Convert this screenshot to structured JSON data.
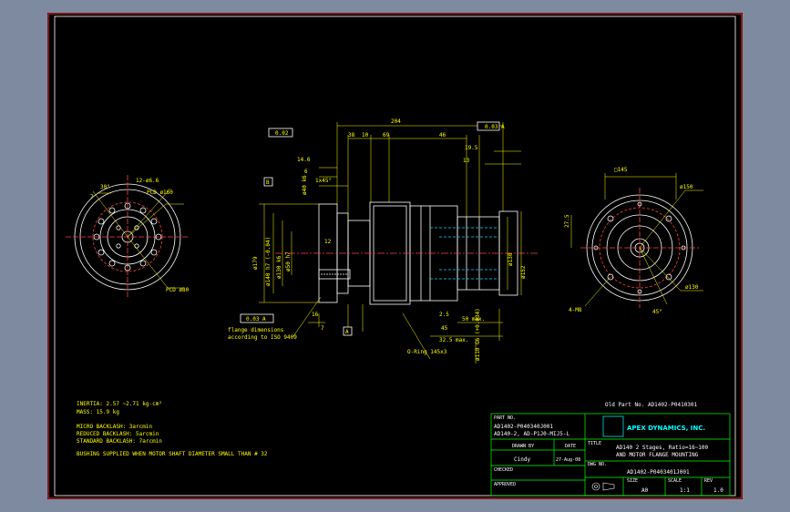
{
  "drawing": {
    "side_dims": {
      "overall": "204",
      "d1": "38",
      "d2": "10",
      "d3": "69",
      "d4": "46",
      "d5": "19.5",
      "d6": "13",
      "d7": "14.6",
      "d8": "6",
      "d9": "1x45°",
      "d10": "12",
      "d11": "16",
      "d12": "7",
      "d13": "2.5",
      "d14": "50 max.",
      "d15": "32.5 max.",
      "d16": "45",
      "dia1": "ø179",
      "dia2": "ø140 h7 (-0.04)",
      "dia3": "ø130 k6",
      "dia4": "ø50 h7",
      "dia5": "ø152",
      "dia6": "ø130",
      "dia7": "ø110 G6 (+0.034)",
      "dia8": "ø40 k6",
      "flatness": "0.03 A",
      "runout": "0.02",
      "runout2": "0.03 A",
      "key_a": "A",
      "key_b": "B",
      "oring": "O-Ring 145x3",
      "flange_note_1": "flange dimensions",
      "flange_note_2": "according to ISO 9409"
    },
    "left_view": {
      "angle": "30°",
      "holes": "12-ø6.6",
      "pcd1": "PCD ø160",
      "pcd2": "PCD ø80",
      "thread": "7"
    },
    "right_view": {
      "sq": "□145",
      "dia_a": "ø150",
      "dia_b": "ø130",
      "h": "27.5",
      "threads": "4-M8",
      "angle": "45°"
    },
    "notes": {
      "inertia": "INERTIA:  2.57 ~2.71 kg-cm²",
      "mass": "MASS: 15.9 kg",
      "micro": "MICRO BACKLASH: 3arcmin",
      "reduced": "REDUCED BACKLASH: 5arcmin",
      "standard": "STANDARD BACKLASH: 7arcmin",
      "bushing": "BUSHING SUPPLIED WHEN MOTOR SHAFT DIAMETER SMALL THAN # 32"
    },
    "old_part": "Old Part No. AD1402-P0410301"
  },
  "title_block": {
    "part_no_label": "PART NO.",
    "part_no_1": "AD1402-P040340J001",
    "part_no_2": "AD140-2, AD-P1J0-MIJ5-L",
    "drawn_label": "DRAWN BY",
    "drawn_by": "Cindy",
    "date_label": "DATE",
    "date": "27-Aug-08",
    "checked_label": "CHECKED",
    "approved_label": "APPROVED",
    "company": "APEX DYNAMICS, INC.",
    "title_label": "TITLE",
    "title_1": "AD140 2 Stages, Ratio=16~100",
    "title_2": "AND MOTOR FLANGE MOUNTING",
    "dwg_label": "DWG NO.",
    "dwg_no": "AD1402-P0403401J001",
    "size_label": "SIZE",
    "size": "A0",
    "scale_label": "SCALE",
    "scale": "1:1",
    "rev_label": "REV",
    "rev": "1.0"
  }
}
